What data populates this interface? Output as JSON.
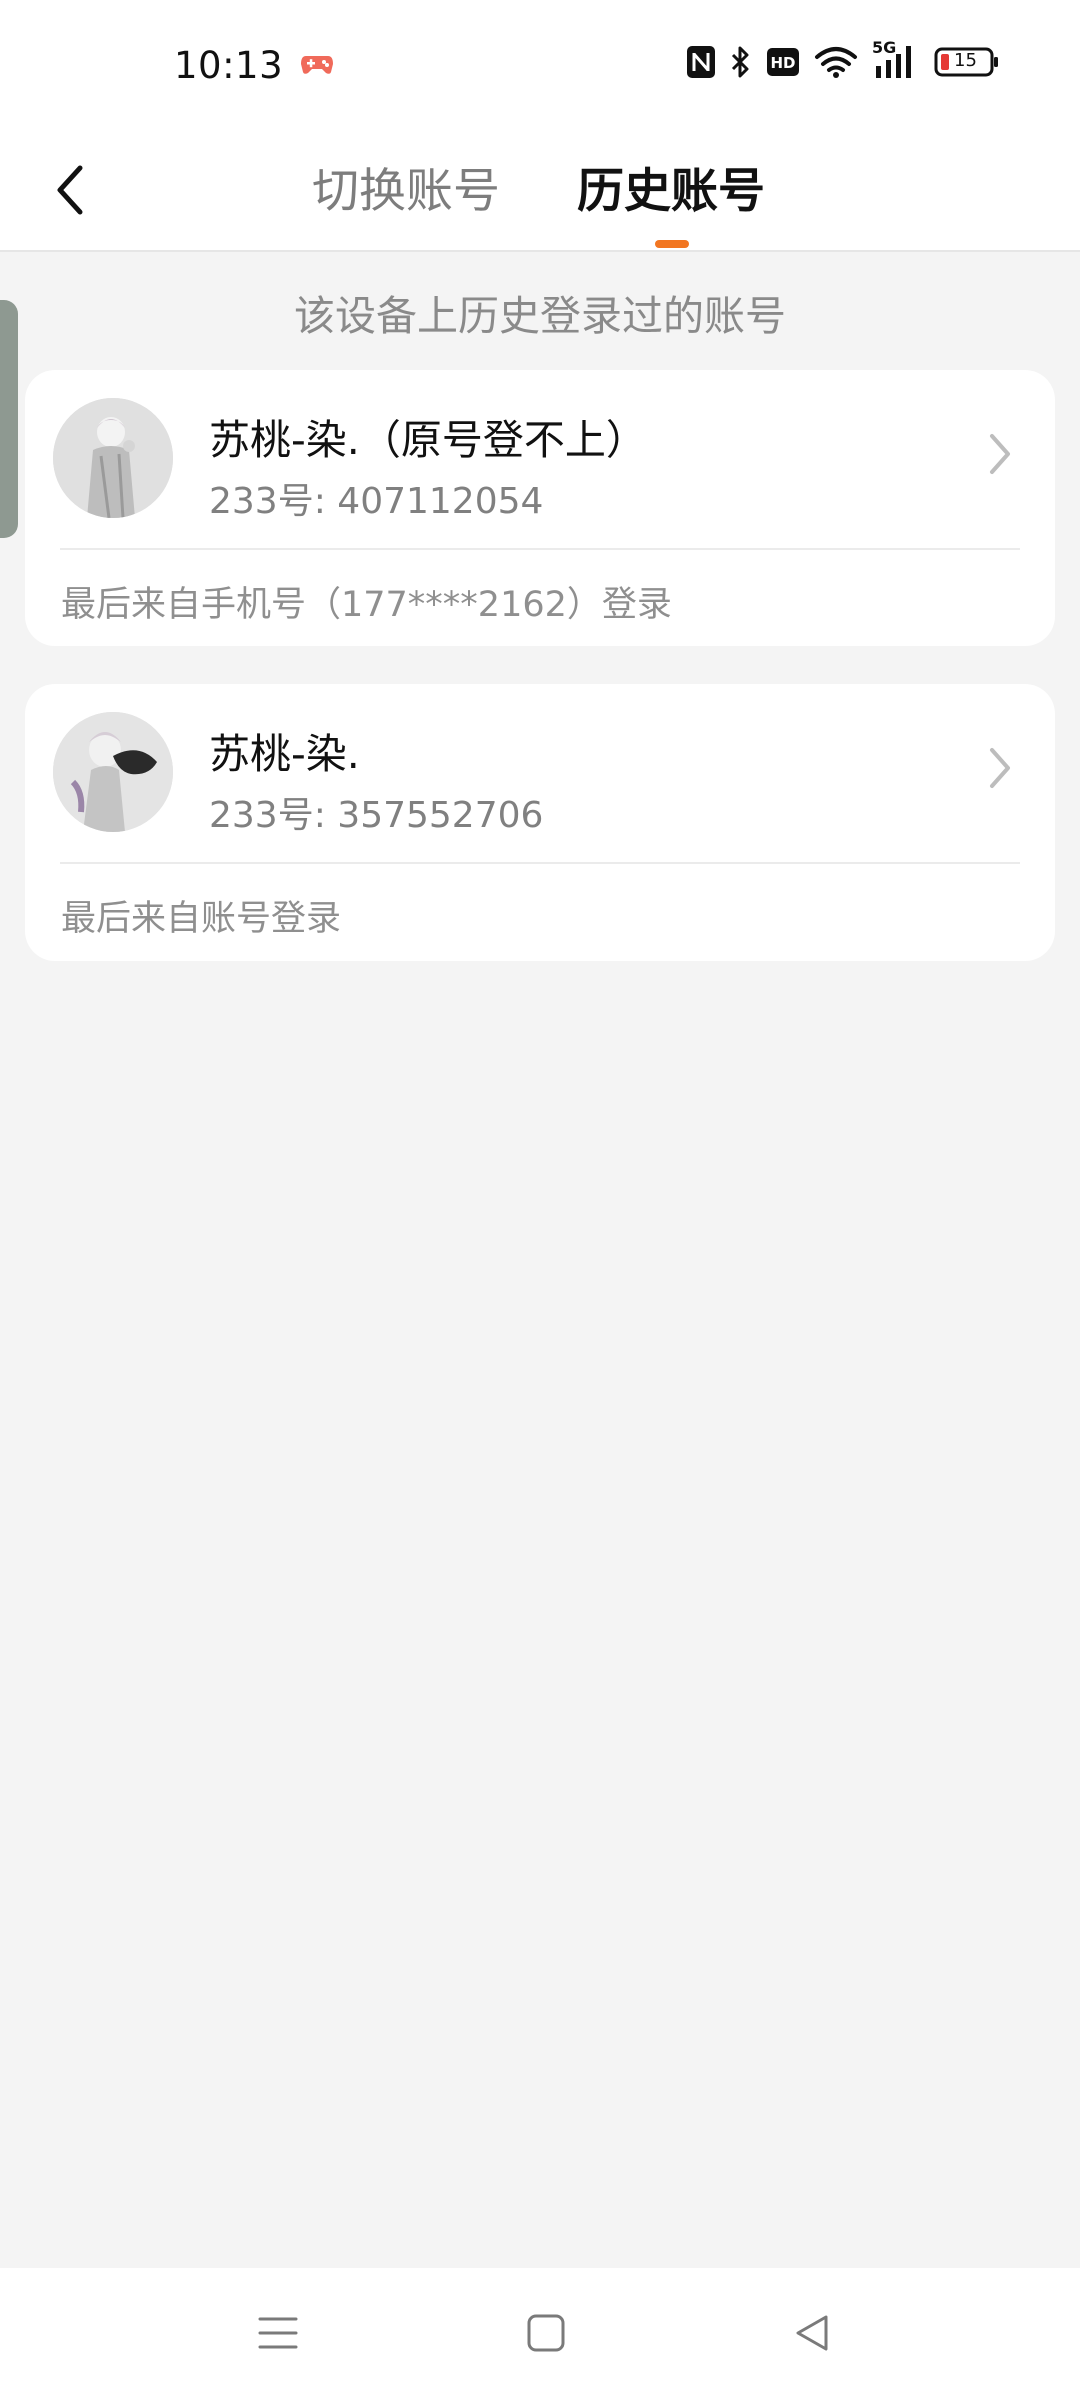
{
  "status_bar": {
    "time": "10:13",
    "battery_level": "15",
    "network_label": "5G",
    "icons": [
      "game-controller-icon",
      "nfc-icon",
      "bluetooth-icon",
      "hd-icon",
      "wifi-icon",
      "cellular-signal-icon",
      "battery-icon"
    ]
  },
  "header": {
    "back_icon": "back-chevron-icon",
    "tabs": [
      {
        "label": "切换账号",
        "active": false
      },
      {
        "label": "历史账号",
        "active": true
      }
    ]
  },
  "subtitle": "该设备上历史登录过的账号",
  "accounts": [
    {
      "name": "苏桃-染.（原号登不上）",
      "id_text": "233号: 407112054",
      "last_login": "最后来自手机号（177****2162）登录"
    },
    {
      "name": "苏桃-染.",
      "id_text": "233号: 357552706",
      "last_login": "最后来自账号登录"
    }
  ],
  "nav_bar": {
    "buttons": [
      "menu-icon",
      "home-icon",
      "back-triangle-icon"
    ]
  },
  "colors": {
    "accent": "#f27621",
    "background": "#f4f4f4",
    "card": "#ffffff",
    "text_secondary": "#8a8a8a"
  }
}
